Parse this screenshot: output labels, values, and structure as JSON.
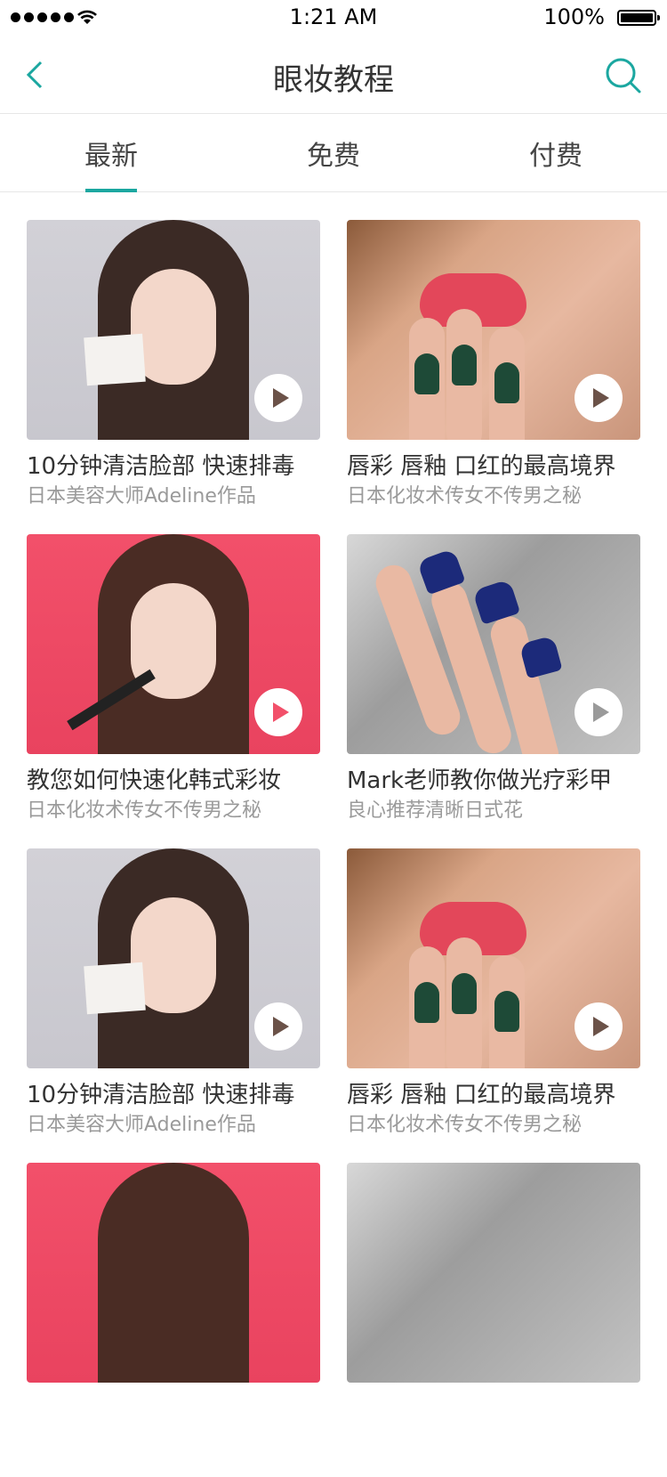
{
  "status_bar": {
    "time": "1:21 AM",
    "battery": "100%"
  },
  "nav": {
    "title": "眼妆教程"
  },
  "tabs": [
    {
      "label": "最新",
      "active": true
    },
    {
      "label": "免费",
      "active": false
    },
    {
      "label": "付费",
      "active": false
    }
  ],
  "cards": [
    {
      "title": "10分钟清洁脸部 快速排毒",
      "subtitle": "日本美容大师Adeline作品"
    },
    {
      "title": "唇彩 唇釉 口红的最高境界",
      "subtitle": "日本化妆术传女不传男之秘"
    },
    {
      "title": "教您如何快速化韩式彩妆",
      "subtitle": "日本化妆术传女不传男之秘"
    },
    {
      "title": "Mark老师教你做光疗彩甲",
      "subtitle": "良心推荐清晰日式花"
    },
    {
      "title": "10分钟清洁脸部 快速排毒",
      "subtitle": "日本美容大师Adeline作品"
    },
    {
      "title": "唇彩 唇釉 口红的最高境界",
      "subtitle": "日本化妆术传女不传男之秘"
    }
  ],
  "colors": {
    "accent": "#1ba7a0"
  }
}
